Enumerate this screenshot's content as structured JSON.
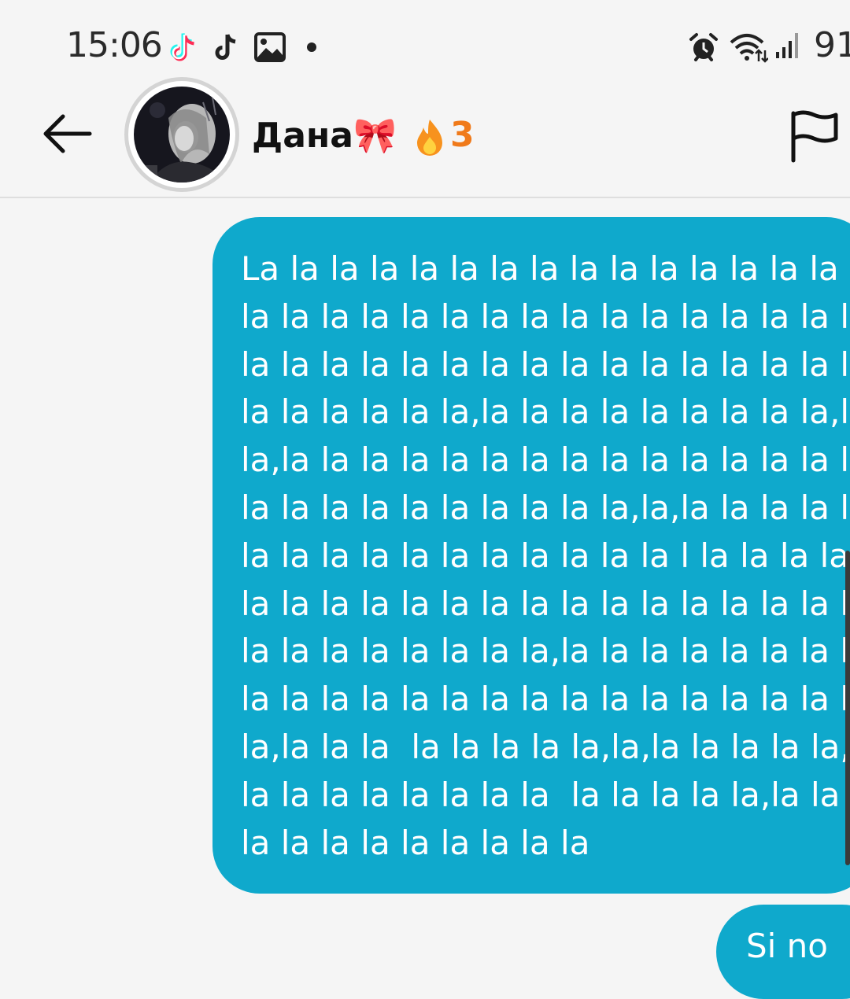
{
  "status_bar": {
    "time": "15:06",
    "battery_text": "91",
    "notification_icons": [
      "tiktok-icon",
      "tiktok-icon",
      "image-icon",
      "dot-icon"
    ],
    "system_icons": [
      "alarm-icon",
      "wifi-icon",
      "signal-icon"
    ]
  },
  "header": {
    "contact_name": "Дана🎀",
    "streak_icon": "fire-icon",
    "streak_count": "3",
    "back_icon": "back-arrow-icon",
    "report_icon": "flag-icon"
  },
  "messages": [
    {
      "from": "me",
      "text": "La la la la la la la la la la la la la la la la\nla la la la la la la la la la la la la la la la\nla la la la la la la la la la la la la la la la\nla la la la la la,la la la la la la la la la,la\nla,la la la la la la la la la la la la la la la\nla la la la la la la la la la,la,la la la la la\nla la la la la la la la la la la l la la la la\nla la la la la la la la la la la la la la la l\nla la la la la la la la,la la la la la la la l\nla la la la la la la la la la la la la la la l\nla,la la la  la la la la la,la,la la la la la,\nla la la la la la la la  la la la la la,la la\nla la la la la la la la la"
    },
    {
      "from": "me",
      "text": "Si no"
    }
  ],
  "colors": {
    "background": "#f5f5f5",
    "bubble": "#0fa9cc",
    "bubble_text": "#ffffff",
    "streak": "#f07a1a"
  }
}
